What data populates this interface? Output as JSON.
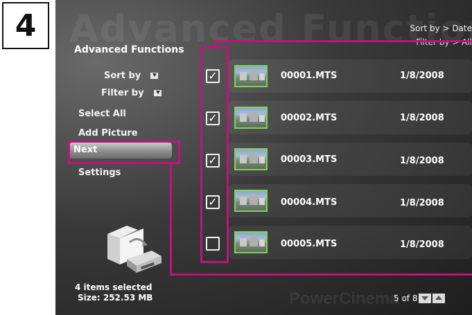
{
  "step_number": "4",
  "watermark_title": "Advanced Functions",
  "panel_title": "Advanced Functions",
  "sort_info": "Sort by > Date",
  "filter_info": "Filter by > All",
  "menu": {
    "sort_by": "Sort by",
    "filter_by": "Filter by",
    "select_all": "Select All",
    "add_picture": "Add Picture",
    "next": "Next",
    "settings": "Settings"
  },
  "files": [
    {
      "name": "00001.MTS",
      "date": "1/8/2008",
      "checked": true
    },
    {
      "name": "00002.MTS",
      "date": "1/8/2008",
      "checked": true
    },
    {
      "name": "00003.MTS",
      "date": "1/8/2008",
      "checked": true
    },
    {
      "name": "00004.MTS",
      "date": "1/8/2008",
      "checked": true
    },
    {
      "name": "00005.MTS",
      "date": "1/8/2008",
      "checked": false
    }
  ],
  "status": {
    "selected": "4 items selected",
    "size": "Size: 252.53 MB"
  },
  "brand": "PowerCinema",
  "pager": "5 of 8",
  "colors": {
    "highlight": "#c2137a",
    "thumb_border": "#7fd35c",
    "background": "#3a3a3a"
  }
}
